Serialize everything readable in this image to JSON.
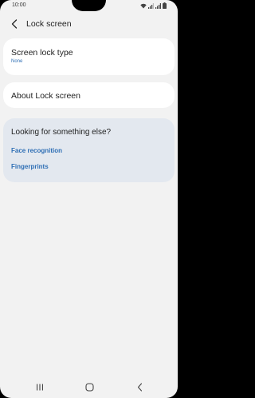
{
  "status_bar": {
    "time": "10:00",
    "icons": [
      "wifi-icon",
      "signal-icon",
      "signal-icon",
      "battery-icon"
    ]
  },
  "header": {
    "title": "Lock screen",
    "back_icon": "chevron-left-icon"
  },
  "lock_type": {
    "title": "Screen lock type",
    "value": "None"
  },
  "about": {
    "title": "About Lock screen"
  },
  "suggestions": {
    "title": "Looking for something else?",
    "links": [
      "Face recognition",
      "Fingerprints"
    ]
  },
  "nav_bar": {
    "icons": [
      "recents-icon",
      "home-icon",
      "back-icon"
    ]
  },
  "colors": {
    "background": "#f2f2f2",
    "card": "#ffffff",
    "suggestion_card": "#e3e8ef",
    "accent": "#2f6fb5",
    "text": "#222222"
  }
}
